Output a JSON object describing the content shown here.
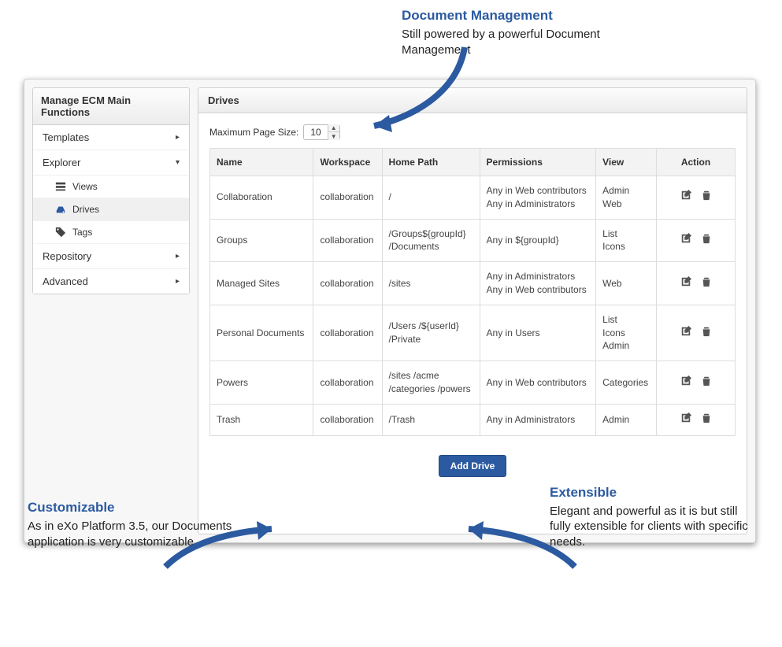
{
  "annotations": {
    "top": {
      "title": "Document Management",
      "text": "Still powered by a powerful Document Management"
    },
    "bl": {
      "title": "Customizable",
      "text": "As in eXo Platform 3.5, our Documents application is very customizable"
    },
    "br": {
      "title": "Extensible",
      "text": "Elegant and powerful as it is but still fully extensible for clients with specific needs."
    }
  },
  "sidebar": {
    "title": "Manage ECM Main Functions",
    "items": [
      {
        "label": "Templates",
        "caret": "▸",
        "selected": false
      },
      {
        "label": "Explorer",
        "caret": "▾",
        "selected": true
      },
      {
        "label": "Repository",
        "caret": "▸",
        "selected": false
      },
      {
        "label": "Advanced",
        "caret": "▸",
        "selected": false
      }
    ],
    "explorer_children": [
      {
        "label": "Views",
        "icon": "views",
        "selected": false
      },
      {
        "label": "Drives",
        "icon": "drives",
        "selected": true
      },
      {
        "label": "Tags",
        "icon": "tags",
        "selected": false
      }
    ]
  },
  "panel": {
    "title": "Drives",
    "page_size_label": "Maximum Page Size:",
    "page_size_value": "10",
    "add_button": "Add Drive",
    "columns": {
      "name": "Name",
      "workspace": "Workspace",
      "home": "Home Path",
      "permissions": "Permissions",
      "view": "View",
      "action": "Action"
    },
    "rows": [
      {
        "name": "Collaboration",
        "workspace": "collaboration",
        "home": "/",
        "permissions": "Any in Web contributors\nAny in Administrators",
        "view": "Admin\nWeb"
      },
      {
        "name": "Groups",
        "workspace": "collaboration",
        "home": "/Groups${groupId}\n/Documents",
        "permissions": "Any in ${groupId}",
        "view": "List\nIcons"
      },
      {
        "name": "Managed Sites",
        "workspace": "collaboration",
        "home": "/sites",
        "permissions": "Any in Administrators\nAny in Web contributors",
        "view": "Web"
      },
      {
        "name": "Personal Documents",
        "workspace": "collaboration",
        "home": "/Users /${userId}\n/Private",
        "permissions": "Any in Users",
        "view": "List\nIcons\nAdmin"
      },
      {
        "name": "Powers",
        "workspace": "collaboration",
        "home": "/sites /acme\n/categories /powers",
        "permissions": "Any in Web contributors",
        "view": "Categories"
      },
      {
        "name": "Trash",
        "workspace": "collaboration",
        "home": "/Trash",
        "permissions": "Any in Administrators",
        "view": "Admin"
      }
    ]
  }
}
